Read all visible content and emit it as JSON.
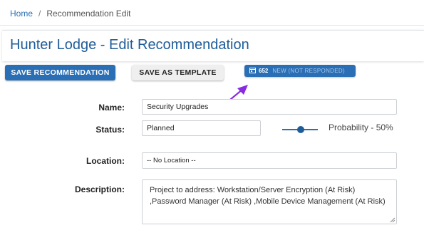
{
  "breadcrumb": {
    "home": "Home",
    "separator": "/",
    "current": "Recommendation Edit"
  },
  "page_title": "Hunter Lodge - Edit Recommendation",
  "toolbar": {
    "save_label": "SAVE RECOMMENDATION",
    "template_label": "SAVE AS TEMPLATE"
  },
  "status_badge": {
    "icon": "calendar-icon",
    "count": "652",
    "state": "NEW (NOT RESPONDED)"
  },
  "form": {
    "name": {
      "label": "Name:",
      "value": "Security Upgrades"
    },
    "status": {
      "label": "Status:",
      "value": "Planned"
    },
    "probability": {
      "text": "Probability - 50%",
      "value": 50
    },
    "location": {
      "label": "Location:",
      "value": "-- No Location --"
    },
    "description": {
      "label": "Description:",
      "value": "Project to address: Workstation/Server Encryption (At Risk) ,Password Manager (At Risk) ,Mobile Device Management (At Risk)"
    }
  },
  "colors": {
    "primary": "#2a6fb5",
    "title": "#1f5d99",
    "annotation_arrow": "#8a2be2"
  }
}
